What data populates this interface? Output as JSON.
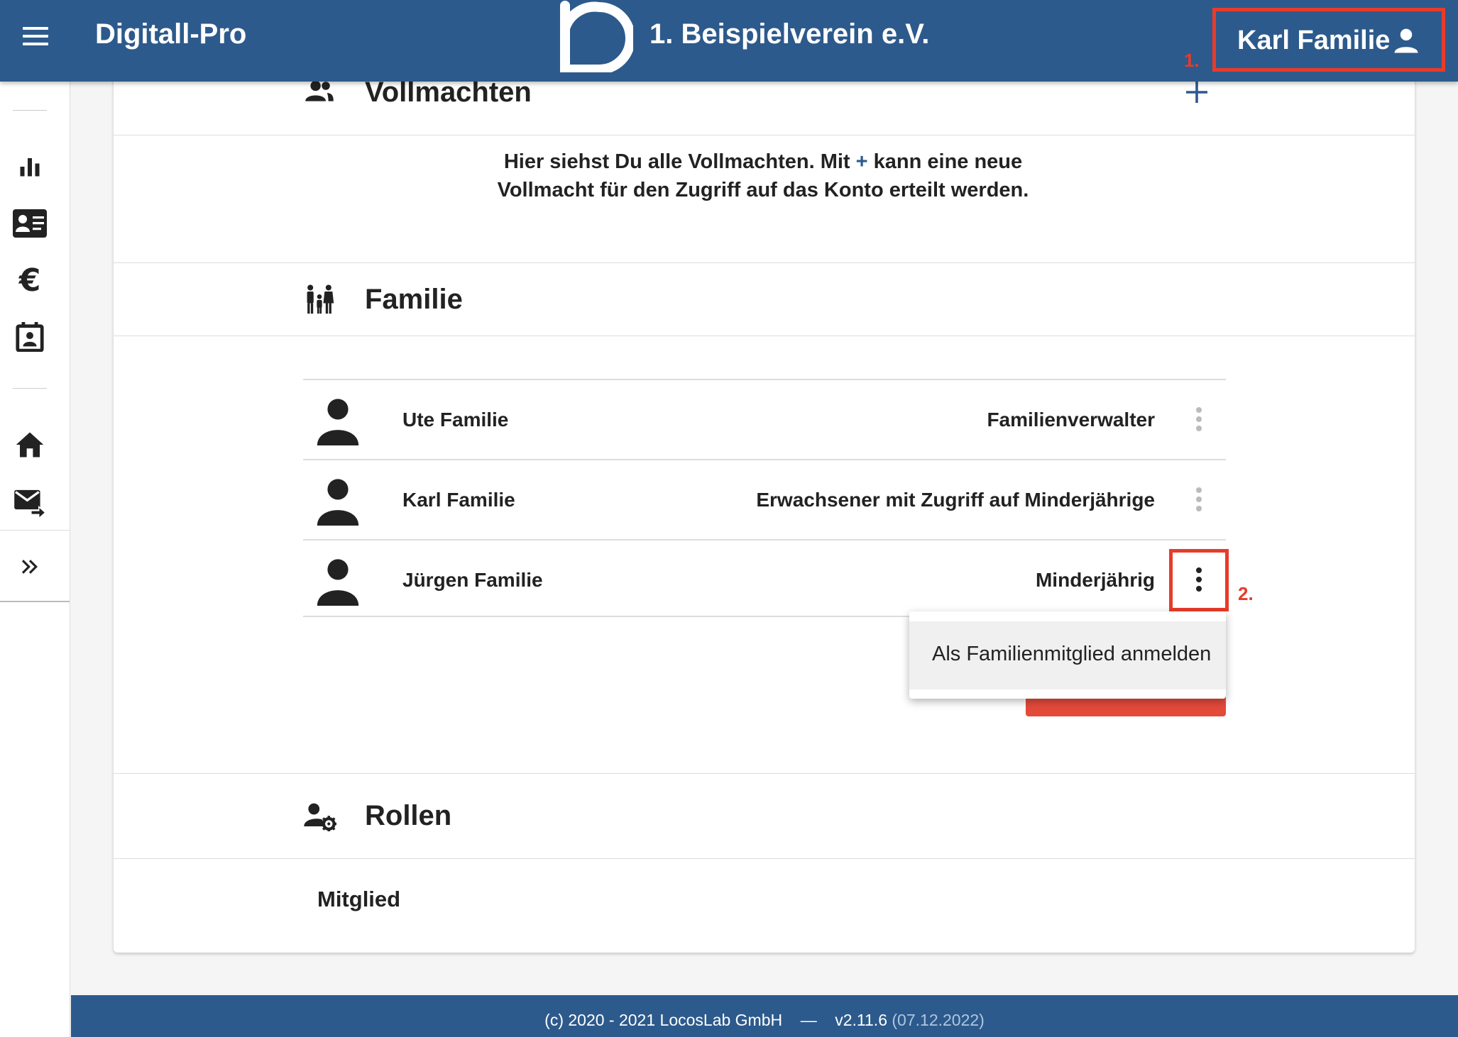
{
  "appbar": {
    "app_title": "Digitall-Pro",
    "org_name": "1. Beispielverein e.V.",
    "user_name": "Karl Familie",
    "marker_1": "1."
  },
  "sidebar": {
    "items": [
      {
        "icon": "bar-chart-icon"
      },
      {
        "icon": "id-card-icon"
      },
      {
        "icon": "euro-icon"
      },
      {
        "icon": "calendar-contact-icon"
      },
      {
        "icon": "home-icon"
      },
      {
        "icon": "mail-forward-icon"
      },
      {
        "icon": "double-chevron-right-icon"
      }
    ]
  },
  "vollmachten": {
    "title": "Vollmachten",
    "info_line1_pre": "Hier siehst Du alle Vollmachten. Mit ",
    "info_plus": "+",
    "info_line1_post": " kann eine neue",
    "info_line2": "Vollmacht für den Zugriff auf das Konto erteilt werden."
  },
  "familie": {
    "title": "Familie",
    "members": [
      {
        "name": "Ute Familie",
        "role": "Familienverwalter"
      },
      {
        "name": "Karl Familie",
        "role": "Erwachsener mit Zugriff auf Minderjährige"
      },
      {
        "name": "Jürgen Familie",
        "role": "Minderjährig"
      }
    ],
    "marker_2": "2.",
    "menu_item": "Als Familienmitglied anmelden"
  },
  "rollen": {
    "title": "Rollen",
    "items": [
      "Mitglied"
    ]
  },
  "footer": {
    "copyright": "(c) 2020 - 2021 LocosLab GmbH",
    "separator": "—",
    "version": "v2.11.6",
    "date": "(07.12.2022)"
  },
  "colors": {
    "primary": "#2d5a8c",
    "highlight": "#e83b2a"
  }
}
